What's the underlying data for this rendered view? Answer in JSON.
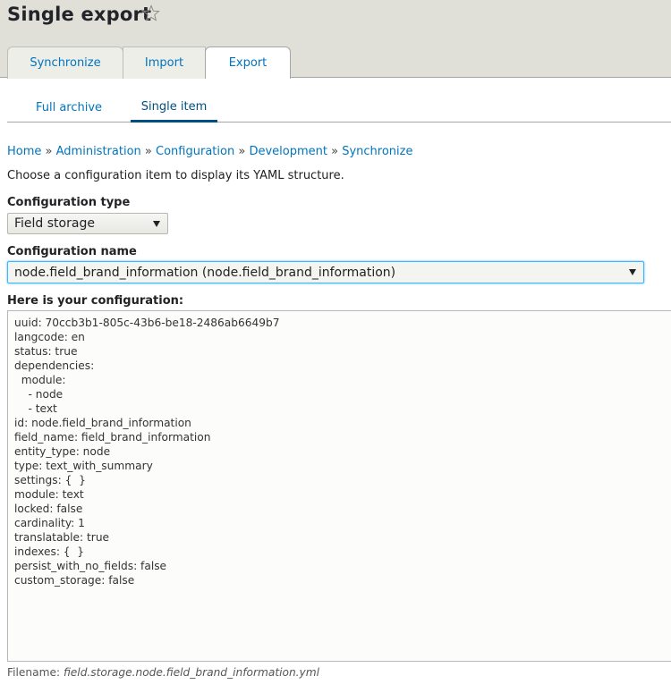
{
  "page": {
    "title": "Single export",
    "star_icon": "star-outline-icon"
  },
  "primary_tabs": [
    {
      "label": "Synchronize",
      "active": false
    },
    {
      "label": "Import",
      "active": false
    },
    {
      "label": "Export",
      "active": true
    }
  ],
  "secondary_tabs": [
    {
      "label": "Full archive",
      "active": false
    },
    {
      "label": "Single item",
      "active": true
    }
  ],
  "breadcrumb": {
    "items": [
      "Home",
      "Administration",
      "Configuration",
      "Development",
      "Synchronize"
    ],
    "separator": "»"
  },
  "intro": "Choose a configuration item to display its YAML structure.",
  "form": {
    "config_type": {
      "label": "Configuration type",
      "value": "Field storage"
    },
    "config_name": {
      "label": "Configuration name",
      "value": "node.field_brand_information (node.field_brand_information)"
    },
    "config_output": {
      "label": "Here is your configuration:",
      "lines": [
        "uuid: 70ccb3b1-805c-43b6-be18-2486ab6649b7",
        "langcode: en",
        "status: true",
        "dependencies:",
        "  module:",
        "    - node",
        "    - text",
        "id: node.field_brand_information",
        "field_name: field_brand_information",
        "entity_type: node",
        "type: text_with_summary",
        "settings: {  }",
        "module: text",
        "locked: false",
        "cardinality: 1",
        "translatable: true",
        "indexes: {  }",
        "persist_with_no_fields: false",
        "custom_storage: false"
      ]
    },
    "filename": {
      "label": "Filename:",
      "value": "field.storage.node.field_brand_information.yml"
    }
  },
  "colors": {
    "link": "#0074bd",
    "active_tab_underline": "#004f80",
    "header_bg": "#e0e0d8",
    "focus_border": "#40b6ff"
  }
}
